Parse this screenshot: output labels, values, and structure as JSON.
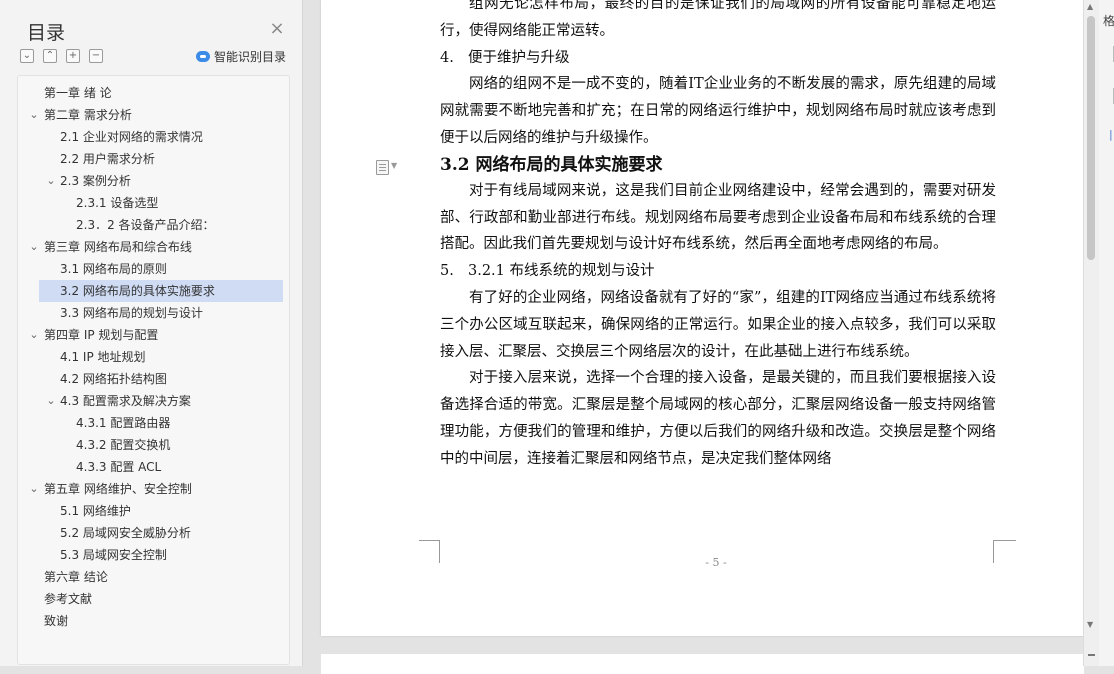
{
  "sidebar": {
    "title": "目录",
    "close_icon": "×",
    "tools": [
      "⌄",
      "⌃",
      "+",
      "−"
    ],
    "smart_label": "智能识别目录",
    "toc": [
      {
        "label": "第一章  绪    论"
      },
      {
        "label": "第二章  需求分析"
      },
      {
        "label": "2.1 企业对网络的需求情况"
      },
      {
        "label": "2.2 用户需求分析"
      },
      {
        "label": "2.3 案例分析"
      },
      {
        "label": "2.3.1  设备选型"
      },
      {
        "label": "2.3．2 各设备产品介绍："
      },
      {
        "label": "第三章  网络布局和综合布线"
      },
      {
        "label": "3.1  网络布局的原则"
      },
      {
        "label": "3.2  网络布局的具体实施要求"
      },
      {
        "label": "3.3  网络布局的规划与设计"
      },
      {
        "label": "第四章  IP 规划与配置"
      },
      {
        "label": "4.1 IP 地址规划"
      },
      {
        "label": "4.2 网络拓扑结构图"
      },
      {
        "label": "4.3  配置需求及解决方案"
      },
      {
        "label": "4.3.1 配置路由器"
      },
      {
        "label": "4.3.2 配置交换机"
      },
      {
        "label": "4.3.3 配置 ACL"
      },
      {
        "label": "第五章    网络维护、安全控制"
      },
      {
        "label": "5.1 网络维护"
      },
      {
        "label": "5.2 局域网安全威胁分析"
      },
      {
        "label": "5.3 局域网安全控制"
      },
      {
        "label": "第六章  结论"
      },
      {
        "label": "参考文献"
      },
      {
        "label": "致谢"
      }
    ]
  },
  "document": {
    "p0": "组网无论怎样布局，最终的目的是保证我们的局域网的所有设备能可靠稳定地运行，使得网络能正常运转。",
    "item4_num": "4.",
    "item4_text": "便于维护与升级",
    "p1": "网络的组网不是一成不变的，随着IT企业业务的不断发展的需求，原先组建的局域网就需要不断地完善和扩充；在日常的网络运行维护中，规划网络布局时就应该考虑到便于以后网络的维护与升级操作。",
    "heading": "3.2  网络布局的具体实施要求",
    "p2": "对于有线局域网来说，这是我们目前企业网络建设中，经常会遇到的，需要对研发部、行政部和勤业部进行布线。规划网络布局要考虑到企业设备布局和布线系统的合理搭配。因此我们首先要规划与设计好布线系统，然后再全面地考虑网络的布局。",
    "item5_num": "5.",
    "item5_text": "3.2.1 布线系统的规划与设计",
    "p3": "有了好的企业网络，网络设备就有了好的“家”，组建的IT网络应当通过布线系统将三个办公区域互联起来，确保网络的正常运行。如果企业的接入点较多，我们可以采取接入层、汇聚层、交换层三个网络层次的设计，在此基础上进行布线系统。",
    "p4": "对于接入层来说，选择一个合理的接入设备，是最关键的，而且我们要根据接入设备选择合适的带宽。汇聚层是整个局域网的核心部分，汇聚层网络设备一般支持网络管理功能，方便我们的管理和维护，方便以后我们的网络升级和改造。交换层是整个网络中的中间层，连接着汇聚层和网络节点，是决定我们整体网络",
    "page_number": "- 5 -"
  },
  "right_panel": {
    "label": "格"
  }
}
